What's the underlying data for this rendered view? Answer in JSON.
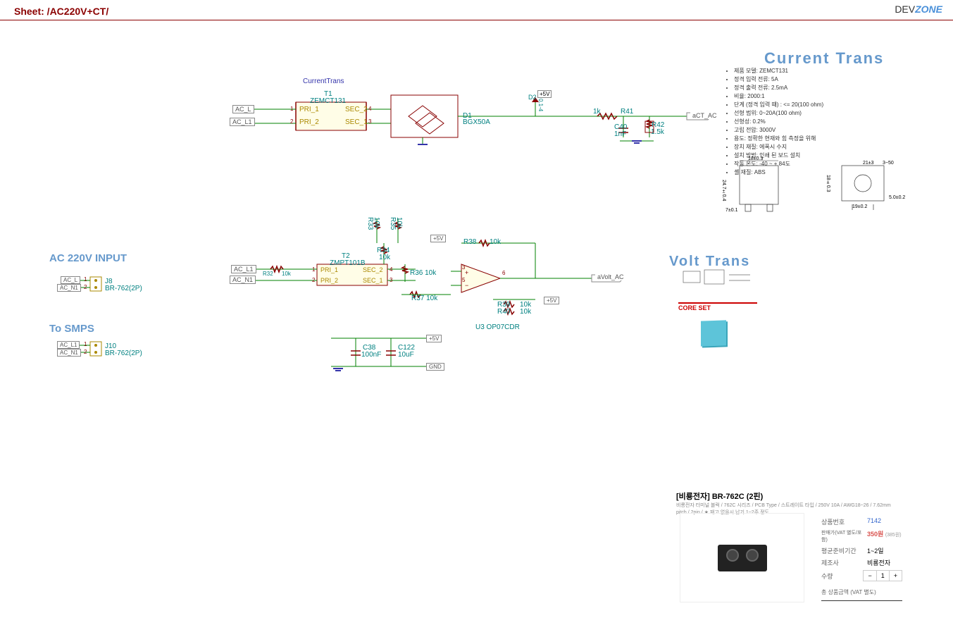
{
  "sheet_title": "Sheet: /AC220V+CT/",
  "logo": {
    "dev": "DEV",
    "zone": "ZONE"
  },
  "sections": {
    "current_trans": "Current Trans",
    "ac_input": "AC 220V INPUT",
    "to_smps": "To SMPS",
    "volt_trans": "Volt Trans",
    "core_set": "CORE SET"
  },
  "ct_block": {
    "ref_label": "CurrentTrans",
    "t1_ref": "T1",
    "t1_part": "ZEMCT131",
    "pri1": "PRI_1",
    "pri2": "PRI_2",
    "sec1": "SEC_1",
    "sec2": "SEC_2",
    "pri1_pin": "1",
    "pri2_pin": "2",
    "sec1_pin": "3",
    "sec2_pin": "4",
    "d1_ref": "D1",
    "d1_part": "BGX50A",
    "d2_ref": "D2",
    "d2_val": "0.1-4",
    "d2_arrow": "↑",
    "v5": "+5V",
    "r41_ref": "R41",
    "r41_val": "1k",
    "c40_ref": "C40",
    "c40_val": "1nF",
    "r42_ref": "R42",
    "r42_val": "1.5k",
    "out_net": "aCT_AC",
    "acl": "AC_L",
    "acl1": "AC_L1"
  },
  "ct_specs": [
    "제품 모델: ZEMCT131",
    "정격 입력 전류: 5A",
    "정격 출력 전류: 2.5mA",
    "비율: 2000:1",
    "단계 (정격 입력 때) : <= 20(100 ohm)",
    "선형 범위: 0~20A(100 ohm)",
    "선형성: 0.2%",
    "고립 전압: 3000V",
    "용도: 정확한 현재와 힘 측정을 위해",
    "장치 재질: 에폭시 수지",
    "설치 방법: 인쇄 된 보드 설치",
    "작동 온도: -40 ~ + 84도",
    "셸 재질: ABS"
  ],
  "vt_block": {
    "t2_ref": "T2",
    "t2_part": "ZMPT101B",
    "pri1": "PRI_1",
    "pri2": "PRI_2",
    "sec1": "SEC_1",
    "sec2": "SEC_2",
    "pri1_pin": "1",
    "pri2_pin": "2",
    "sec1_pin": "3",
    "sec2_pin": "4",
    "r32": "R32",
    "r32_val": "10k",
    "r33": "R33",
    "r33_val": "10k",
    "r34": "R34",
    "r34_val": "10k",
    "r35": "R35",
    "r35_val": "10k",
    "r36": "R36  10k",
    "r37": "R37  10k",
    "r38": "R38",
    "r38_val": "10k",
    "r39": "R39",
    "r39_val": "10k",
    "r40": "R40",
    "r40_val": "10k",
    "u3": "U3 OP07CDR",
    "c38_ref": "C38",
    "c38_val": "100nF",
    "c122_ref": "C122",
    "c122_val": "10uF",
    "v5": "+5V",
    "gnd": "GND",
    "out_net": "aVolt_AC",
    "acl1": "AC_L1",
    "acn1": "AC_N1",
    "pin3": "3",
    "pin5": "5",
    "pin6": "6"
  },
  "connectors": {
    "j8_ref": "J8",
    "j8_part": "BR-762(2P)",
    "j10_ref": "J10",
    "j10_part": "BR-762(2P)",
    "pin1": "1",
    "pin2": "2",
    "acl": "AC_L",
    "acn1": "AC_N1",
    "acl1": "AC_L1"
  },
  "product": {
    "title": "[비룡전자] BR-762C (2핀)",
    "subtitle": "비룡전자 터미널 블럭 / 762C 시리즈 / PCB Type / 스트레이트 타입 / 250V 10A / AWG18~26 / 7.62mm pitch / 2pin / ★ 재고 없을시 납기 1~2주 정도",
    "rows": {
      "code_label": "상품번호",
      "code": "7142",
      "price_label": "판매가(VAT 별도/포함)",
      "price": "350원",
      "price_inc": "(385원)",
      "lead_label": "평균준비기간",
      "lead": "1~2일",
      "maker_label": "제조사",
      "maker": "비룡전자",
      "qty_label": "수량"
    },
    "total_label": "총 상품금액 (VAT 별도)",
    "qty_value": "1"
  },
  "dimensions": {
    "d1": "18±0.3",
    "d2": "24.7±0.4",
    "d3": "7±0.1",
    "d4": "21±3",
    "d5": "3~50",
    "d6": "5.0±0.2",
    "d7": "18±0.3",
    "d8": "19±0.2"
  }
}
